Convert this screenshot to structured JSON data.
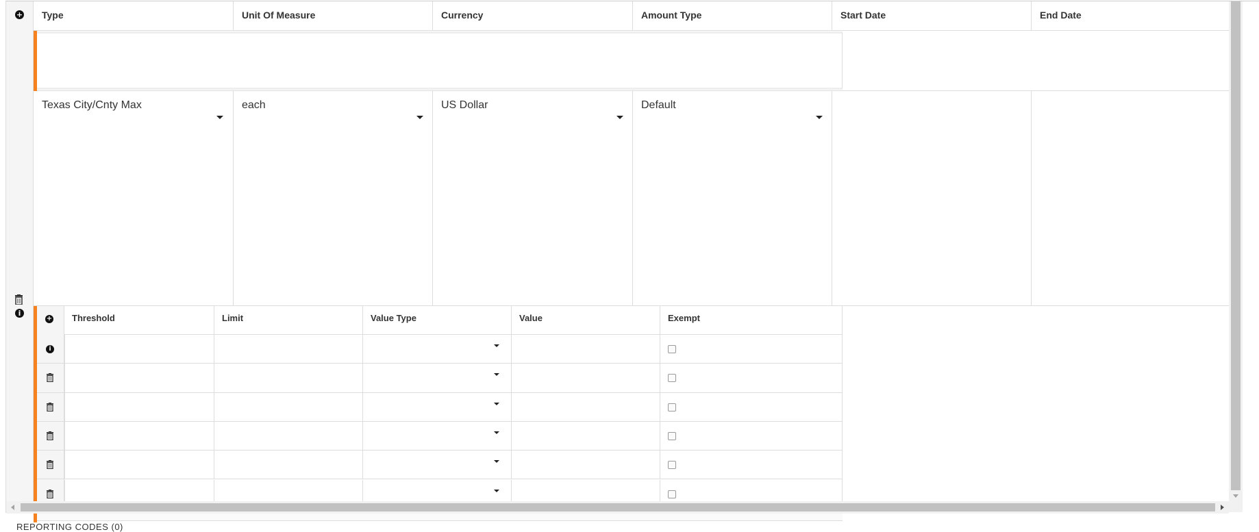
{
  "grid": {
    "add_icon": "plus-circle-icon",
    "columns": [
      "Type",
      "Unit Of Measure",
      "Currency",
      "Amount Type",
      "Start Date",
      "End Date"
    ],
    "row": {
      "type": "Texas City/Cnty Max",
      "unit_of_measure": "each",
      "currency": "US Dollar",
      "amount_type": "Default",
      "start_date": "",
      "end_date": "",
      "icons": [
        "trash-icon",
        "info-icon"
      ]
    }
  },
  "nested_grid": {
    "add_icon": "plus-circle-icon",
    "columns": [
      "Threshold",
      "Limit",
      "Value Type",
      "Value",
      "Exempt"
    ],
    "rows": [
      {
        "icon": "info-icon",
        "threshold": "",
        "limit": "",
        "value_type": "",
        "value": "",
        "exempt": false
      },
      {
        "icon": "trash-icon",
        "threshold": "",
        "limit": "",
        "value_type": "",
        "value": "",
        "exempt": false
      },
      {
        "icon": "trash-icon",
        "threshold": "",
        "limit": "",
        "value_type": "",
        "value": "",
        "exempt": false
      },
      {
        "icon": "trash-icon",
        "threshold": "",
        "limit": "",
        "value_type": "",
        "value": "",
        "exempt": false
      },
      {
        "icon": "trash-icon",
        "threshold": "",
        "limit": "",
        "value_type": "",
        "value": "",
        "exempt": false
      },
      {
        "icon": "trash-icon",
        "threshold": "",
        "limit": "",
        "value_type": "",
        "value": "",
        "exempt": false
      }
    ]
  },
  "footer": {
    "section_label": "REPORTING CODES (0)"
  },
  "colors": {
    "accent": "#f5821f",
    "grid_border": "#dddddd",
    "gutter": "#f5f5f5",
    "scrollbar": "#c1c1c1"
  }
}
